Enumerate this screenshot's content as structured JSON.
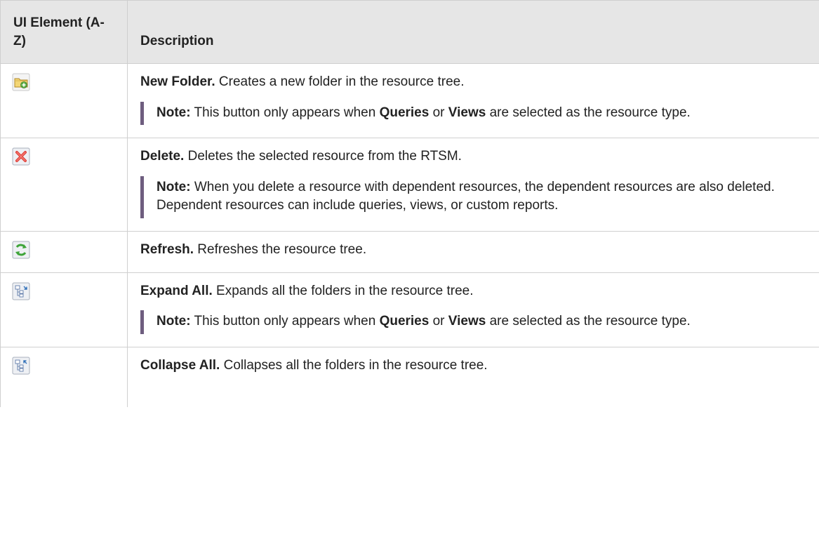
{
  "table": {
    "header": {
      "col1": "UI Element (A-Z)",
      "col2": "Description"
    },
    "rows": [
      {
        "icon": "new-folder-icon",
        "title": "New Folder.",
        "text": " Creates a new folder in the resource tree.",
        "note": {
          "label": "Note:",
          "pre": "  This button only appears when ",
          "b1": "Queries",
          "mid": " or ",
          "b2": "Views",
          "post": " are selected as the resource type."
        }
      },
      {
        "icon": "delete-icon",
        "title": "Delete.",
        "text": " Deletes the selected resource from the RTSM.",
        "note": {
          "label": "Note:",
          "text": "  When you delete a resource with dependent resources, the dependent resources are also deleted. Dependent resources can include queries, views, or custom reports."
        }
      },
      {
        "icon": "refresh-icon",
        "title": "Refresh.",
        "text": " Refreshes the resource tree."
      },
      {
        "icon": "expand-all-icon",
        "title": "Expand All.",
        "text": " Expands all the folders in the resource tree.",
        "note": {
          "label": "Note:",
          "pre": "  This button only appears when ",
          "b1": "Queries",
          "mid": " or ",
          "b2": "Views",
          "post": " are selected as the resource type."
        }
      },
      {
        "icon": "collapse-all-icon",
        "title": "Collapse All.",
        "text": " Collapses all the folders in the resource tree."
      }
    ]
  }
}
